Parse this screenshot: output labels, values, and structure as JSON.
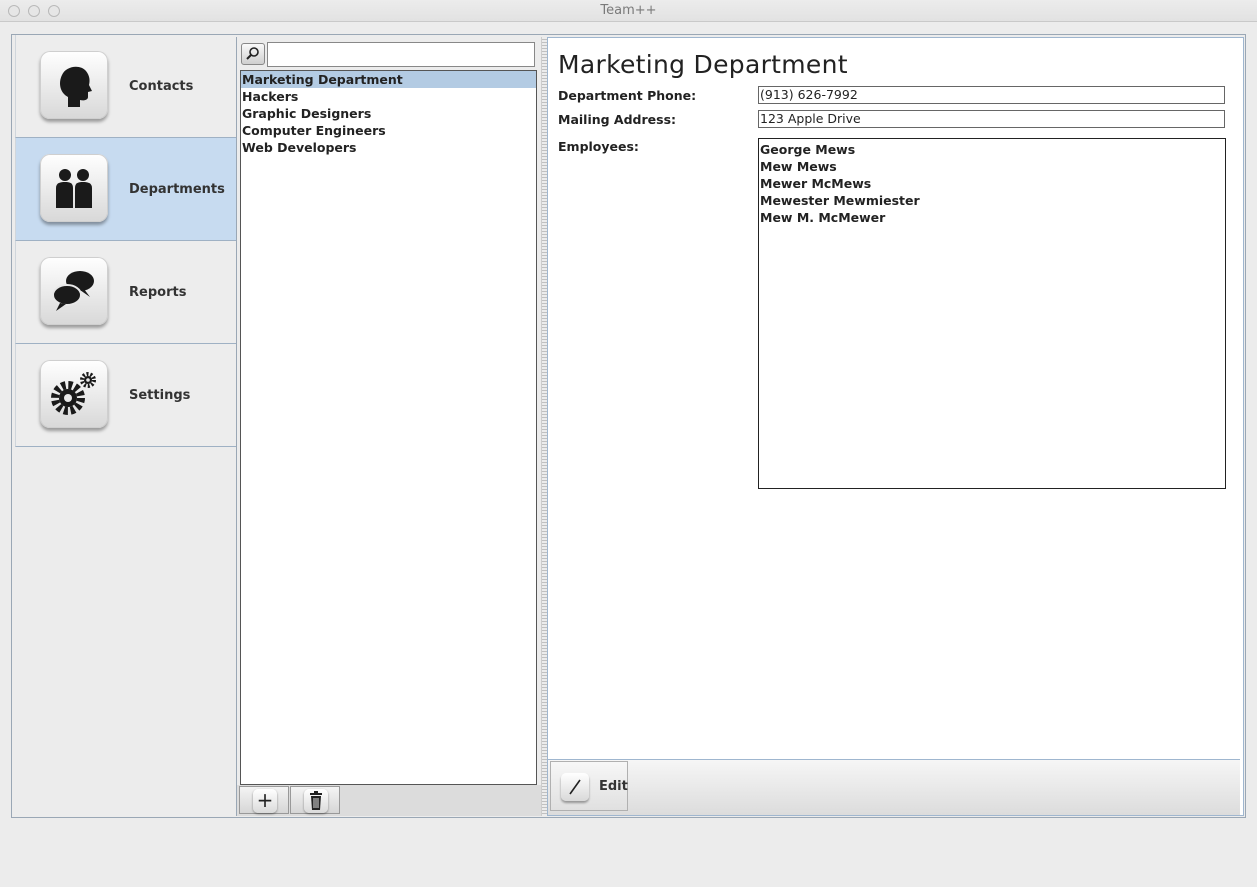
{
  "window": {
    "title": "Team++"
  },
  "nav": {
    "items": [
      {
        "label": "Contacts",
        "icon": "head-icon",
        "selected": false
      },
      {
        "label": "Departments",
        "icon": "people-icon",
        "selected": true
      },
      {
        "label": "Reports",
        "icon": "speech-bubbles-icon",
        "selected": false
      },
      {
        "label": "Settings",
        "icon": "gears-icon",
        "selected": false
      }
    ]
  },
  "list": {
    "search": {
      "value": "",
      "placeholder": ""
    },
    "items": [
      "Marketing Department",
      "Hackers",
      "Graphic Designers",
      "Computer Engineers",
      "Web Developers"
    ],
    "selected_index": 0,
    "add_icon": "plus-icon",
    "delete_icon": "trash-icon"
  },
  "detail": {
    "title": "Marketing Department",
    "phone_label": "Department Phone:",
    "phone_value": "(913) 626-7992",
    "address_label": "Mailing Address:",
    "address_value": "123 Apple Drive",
    "employees_label": "Employees:",
    "employees": [
      "George Mews",
      "Mew Mews",
      "Mewer McMews",
      "Mewester Mewmiester",
      "Mew M. McMewer"
    ],
    "edit_label": "Edit",
    "edit_icon": "pencil-icon"
  },
  "colors": {
    "selection": "#b3cbe3",
    "nav_selected": "#c7dbf0",
    "border_accent": "#9fb6cf"
  }
}
